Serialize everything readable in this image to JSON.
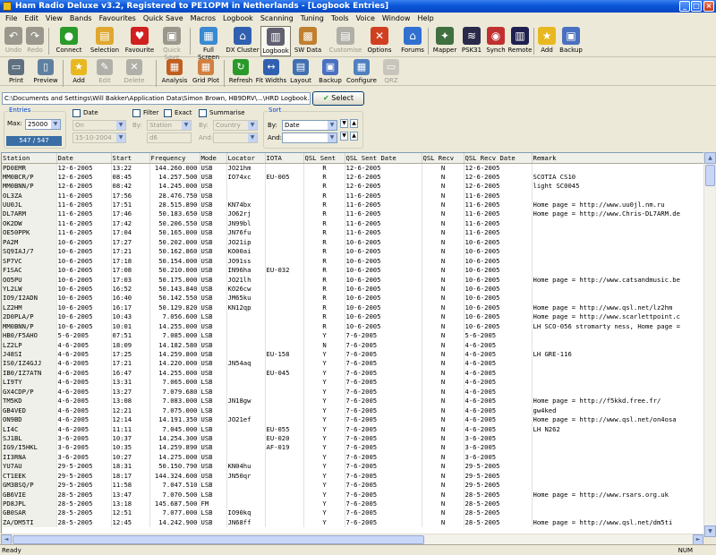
{
  "window": {
    "title": "Ham Radio Deluxe v3.2, Registered to PE1OPM in Netherlands - [Logbook Entries]"
  },
  "menu": [
    "File",
    "Edit",
    "View",
    "Bands",
    "Favourites",
    "Quick Save",
    "Macros",
    "Logbook",
    "Scanning",
    "Tuning",
    "Tools",
    "Voice",
    "Window",
    "Help"
  ],
  "toolbar1": [
    {
      "label": "Undo",
      "icon": "undo-icon",
      "disabled": true
    },
    {
      "label": "Redo",
      "icon": "redo-icon",
      "disabled": true
    },
    {
      "label": "Connect",
      "icon": "connect-icon"
    },
    {
      "label": "Selection",
      "icon": "folder-icon"
    },
    {
      "label": "Favourite",
      "icon": "heart-icon"
    },
    {
      "label": "Quick Save",
      "icon": "floppy-icon",
      "disabled": true
    },
    {
      "label": "Full Screen",
      "icon": "fullscreen-icon"
    },
    {
      "label": "DX Cluster",
      "icon": "cluster-icon"
    },
    {
      "label": "Logbook",
      "icon": "logbook-icon",
      "active": true
    },
    {
      "label": "SW Data",
      "icon": "box-icon"
    },
    {
      "label": "Customise",
      "icon": "customise-icon",
      "disabled": true
    },
    {
      "label": "Options",
      "icon": "tools-icon"
    },
    {
      "label": "Forums",
      "icon": "house-icon"
    },
    {
      "label": "Mapper",
      "icon": "mapper-icon"
    },
    {
      "label": "PSK31",
      "icon": "psk-icon"
    },
    {
      "label": "Synch",
      "icon": "synch-icon"
    },
    {
      "label": "Remote",
      "icon": "remote-icon"
    },
    {
      "label": "Add",
      "icon": "star-icon"
    },
    {
      "label": "Backup",
      "icon": "backup-icon"
    }
  ],
  "toolbar2": [
    {
      "label": "Print",
      "icon": "printer-icon"
    },
    {
      "label": "Preview",
      "icon": "preview-icon"
    },
    {
      "label": "Add",
      "icon": "star-icon"
    },
    {
      "label": "Edit",
      "icon": "edit-icon",
      "disabled": true
    },
    {
      "label": "Delete",
      "icon": "delete-icon",
      "disabled": true
    },
    {
      "label": "Analysis",
      "icon": "analysis-icon"
    },
    {
      "label": "Grid Plot",
      "icon": "gridplot-icon"
    },
    {
      "label": "Refresh",
      "icon": "refresh-icon"
    },
    {
      "label": "Fit Widths",
      "icon": "fitwidths-icon"
    },
    {
      "label": "Layout",
      "icon": "layout-icon"
    },
    {
      "label": "Backup",
      "icon": "backup-icon"
    },
    {
      "label": "Configure",
      "icon": "configure-icon"
    },
    {
      "label": "QRZ",
      "icon": "qrz-icon",
      "disabled": true
    }
  ],
  "path": "C:\\Documents and Settings\\Will Bakker\\Application Data\\Simon Brown, HB9DRV\\...\\HRD Logbook.mdb (332 KB)",
  "select_label": "Select",
  "entries": {
    "title": "Entries",
    "max_label": "Max:",
    "max_value": "25000",
    "count": "547 / 547"
  },
  "date_filter": {
    "label": "Date",
    "op": "On",
    "value": "15-10-2004"
  },
  "filter": {
    "label": "Filter",
    "exact_label": "Exact",
    "by_label": "By:",
    "by_value": "Station",
    "value": "d6"
  },
  "summarise": {
    "label": "Summarise",
    "by_label": "By:",
    "by_value": "Country",
    "and_label": "And:"
  },
  "sort": {
    "title": "Sort",
    "by_label": "By:",
    "by_value": "Date",
    "and_label": "And:",
    "and_value": ""
  },
  "columns": [
    "Station",
    "Date",
    "Start",
    "Frequency",
    "Mode",
    "Locator",
    "IOTA",
    "QSL Sent",
    "QSL Sent Date",
    "QSL Recv",
    "QSL Recv Date",
    "Remark"
  ],
  "rows": [
    [
      "PD0EMR",
      "12-6-2005",
      "13:22",
      "144.260.000",
      "USB",
      "JO21hm",
      "",
      "R",
      "12-6-2005",
      "N",
      "12-6-2005",
      ""
    ],
    [
      "MM0BCR/P",
      "12-6-2005",
      "08:45",
      "14.257.500",
      "USB",
      "IO74xc",
      "EU-005",
      "R",
      "12-6-2005",
      "N",
      "12-6-2005",
      "SCOTIA CS10"
    ],
    [
      "MM0BNN/P",
      "12-6-2005",
      "08:42",
      "14.245.000",
      "USB",
      "",
      "",
      "R",
      "12-6-2005",
      "N",
      "12-6-2005",
      "light SC0045"
    ],
    [
      "OL3ZA",
      "11-6-2005",
      "17:56",
      "28.476.750",
      "USB",
      "",
      "",
      "R",
      "11-6-2005",
      "N",
      "11-6-2005",
      ""
    ],
    [
      "UU0JL",
      "11-6-2005",
      "17:51",
      "28.515.890",
      "USB",
      "KN74bx",
      "",
      "R",
      "11-6-2005",
      "N",
      "11-6-2005",
      "Home page = http://www.uu0jl.nm.ru"
    ],
    [
      "DL7ARM",
      "11-6-2005",
      "17:46",
      "50.183.650",
      "USB",
      "JO62rj",
      "",
      "R",
      "11-6-2005",
      "N",
      "11-6-2005",
      "Home page = http://www.Chris-DL7ARM.de"
    ],
    [
      "OK2DW",
      "11-6-2005",
      "17:42",
      "50.206.550",
      "USB",
      "JN99bl",
      "",
      "R",
      "11-6-2005",
      "N",
      "11-6-2005",
      ""
    ],
    [
      "OE50PPK",
      "11-6-2005",
      "17:04",
      "50.165.000",
      "USB",
      "JN76fu",
      "",
      "R",
      "11-6-2005",
      "N",
      "11-6-2005",
      ""
    ],
    [
      "PA2M",
      "10-6-2005",
      "17:27",
      "50.202.000",
      "USB",
      "JO21ip",
      "",
      "R",
      "10-6-2005",
      "N",
      "10-6-2005",
      ""
    ],
    [
      "SQ9IAJ/7",
      "10-6-2005",
      "17:21",
      "50.162.860",
      "USB",
      "KO00ai",
      "",
      "R",
      "10-6-2005",
      "N",
      "10-6-2005",
      ""
    ],
    [
      "SP7VC",
      "10-6-2005",
      "17:18",
      "50.154.000",
      "USB",
      "JO91ss",
      "",
      "R",
      "10-6-2005",
      "N",
      "10-6-2005",
      ""
    ],
    [
      "F1SAC",
      "10-6-2005",
      "17:08",
      "50.210.000",
      "USB",
      "IN96ha",
      "EU-032",
      "R",
      "10-6-2005",
      "N",
      "10-6-2005",
      ""
    ],
    [
      "OO5PU",
      "10-6-2005",
      "17:03",
      "50.175.000",
      "USB",
      "JO21lh",
      "",
      "R",
      "10-6-2005",
      "N",
      "10-6-2005",
      "Home page = http://www.catsandmusic.be"
    ],
    [
      "YL2LW",
      "10-6-2005",
      "16:52",
      "50.143.840",
      "USB",
      "KO26cw",
      "",
      "R",
      "10-6-2005",
      "N",
      "10-6-2005",
      ""
    ],
    [
      "IO9/I2ADN",
      "10-6-2005",
      "16:40",
      "50.142.550",
      "USB",
      "JM65ku",
      "",
      "R",
      "10-6-2005",
      "N",
      "10-6-2005",
      ""
    ],
    [
      "LZ2HM",
      "10-6-2005",
      "16:17",
      "50.129.820",
      "USB",
      "KN12qp",
      "",
      "R",
      "10-6-2005",
      "N",
      "10-6-2005",
      "Home page = http://www.qsl.net/lz2hm"
    ],
    [
      "2D0PLA/P",
      "10-6-2005",
      "10:43",
      "7.056.600",
      "LSB",
      "",
      "",
      "R",
      "10-6-2005",
      "N",
      "10-6-2005",
      "Home page = http://www.scarlettpoint.c"
    ],
    [
      "MM0BNN/P",
      "10-6-2005",
      "10:01",
      "14.255.000",
      "USB",
      "",
      "",
      "R",
      "10-6-2005",
      "N",
      "10-6-2005",
      "LH SCO-056 stromarty ness, Home page ="
    ],
    [
      "HB0/F5AHO",
      "5-6-2005",
      "07:51",
      "7.085.000",
      "LSB",
      "",
      "",
      "Y",
      "7-6-2005",
      "N",
      "5-6-2005",
      ""
    ],
    [
      "LZ2LP",
      "4-6-2005",
      "18:09",
      "14.182.580",
      "USB",
      "",
      "",
      "N",
      "7-6-2005",
      "N",
      "4-6-2005",
      ""
    ],
    [
      "J48SI",
      "4-6-2005",
      "17:25",
      "14.259.800",
      "USB",
      "",
      "EU-158",
      "Y",
      "7-6-2005",
      "N",
      "4-6-2005",
      "LH GRE-116"
    ],
    [
      "IS0/IZ4GJJ",
      "4-6-2005",
      "17:21",
      "14.220.000",
      "USB",
      "JN54aq",
      "",
      "Y",
      "7-6-2005",
      "N",
      "4-6-2005",
      ""
    ],
    [
      "IB0/IZ7ATN",
      "4-6-2005",
      "16:47",
      "14.255.000",
      "USB",
      "",
      "EU-045",
      "Y",
      "7-6-2005",
      "N",
      "4-6-2005",
      ""
    ],
    [
      "LI9TY",
      "4-6-2005",
      "13:31",
      "7.065.000",
      "LSB",
      "",
      "",
      "Y",
      "7-6-2005",
      "N",
      "4-6-2005",
      ""
    ],
    [
      "GX4CDP/P",
      "4-6-2005",
      "13:27",
      "7.079.680",
      "LSB",
      "",
      "",
      "Y",
      "7-6-2005",
      "N",
      "4-6-2005",
      ""
    ],
    [
      "TM5KD",
      "4-6-2005",
      "13:08",
      "7.083.000",
      "LSB",
      "JN18gw",
      "",
      "Y",
      "7-6-2005",
      "N",
      "4-6-2005",
      "Home page = http://f5kkd.free.fr/"
    ],
    [
      "GB4VED",
      "4-6-2005",
      "12:21",
      "7.075.000",
      "LSB",
      "",
      "",
      "Y",
      "7-6-2005",
      "N",
      "4-6-2005",
      "gw4ked"
    ],
    [
      "ON9BD",
      "4-6-2005",
      "12:14",
      "14.191.350",
      "USB",
      "JO21ef",
      "",
      "Y",
      "7-6-2005",
      "N",
      "4-6-2005",
      "Home page = http://www.qsl.net/on4osa"
    ],
    [
      "LI4C",
      "4-6-2005",
      "11:11",
      "7.045.000",
      "LSB",
      "",
      "EU-055",
      "Y",
      "7-6-2005",
      "N",
      "4-6-2005",
      "LH N262"
    ],
    [
      "SJ1BL",
      "3-6-2005",
      "10:37",
      "14.254.300",
      "USB",
      "",
      "EU-020",
      "Y",
      "7-6-2005",
      "N",
      "3-6-2005",
      ""
    ],
    [
      "IG9/I5HKL",
      "3-6-2005",
      "10:35",
      "14.259.890",
      "USB",
      "",
      "AF-019",
      "Y",
      "7-6-2005",
      "N",
      "3-6-2005",
      ""
    ],
    [
      "II3RNA",
      "3-6-2005",
      "10:27",
      "14.275.000",
      "USB",
      "",
      "",
      "Y",
      "7-6-2005",
      "N",
      "3-6-2005",
      ""
    ],
    [
      "YU7AU",
      "29-5-2005",
      "18:31",
      "50.150.790",
      "USB",
      "KN04hu",
      "",
      "Y",
      "7-6-2005",
      "N",
      "29-5-2005",
      ""
    ],
    [
      "CT1EEK",
      "29-5-2005",
      "18:17",
      "144.324.600",
      "USB",
      "JN50qr",
      "",
      "Y",
      "7-6-2005",
      "N",
      "29-5-2005",
      ""
    ],
    [
      "GM3BSQ/P",
      "29-5-2005",
      "11:58",
      "7.047.510",
      "LSB",
      "",
      "",
      "Y",
      "7-6-2005",
      "N",
      "29-5-2005",
      ""
    ],
    [
      "GB6VIE",
      "28-5-2005",
      "13:47",
      "7.070.500",
      "LSB",
      "",
      "",
      "Y",
      "7-6-2005",
      "N",
      "28-5-2005",
      "Home page = http://www.rsars.org.uk"
    ],
    [
      "PD8JPL",
      "28-5-2005",
      "13:18",
      "145.687.500",
      "FM",
      "",
      "",
      "Y",
      "7-6-2005",
      "N",
      "28-5-2005",
      ""
    ],
    [
      "GB0SAR",
      "28-5-2005",
      "12:51",
      "7.077.000",
      "LSB",
      "IO90kq",
      "",
      "Y",
      "7-6-2005",
      "N",
      "28-5-2005",
      ""
    ],
    [
      "ZA/DM5TI",
      "28-5-2005",
      "12:45",
      "14.242.900",
      "USB",
      "JN68ff",
      "",
      "Y",
      "7-6-2005",
      "N",
      "28-5-2005",
      "Home page = http://www.qsl.net/dm5ti"
    ]
  ],
  "status": {
    "left": "Ready",
    "right": "NUM"
  }
}
